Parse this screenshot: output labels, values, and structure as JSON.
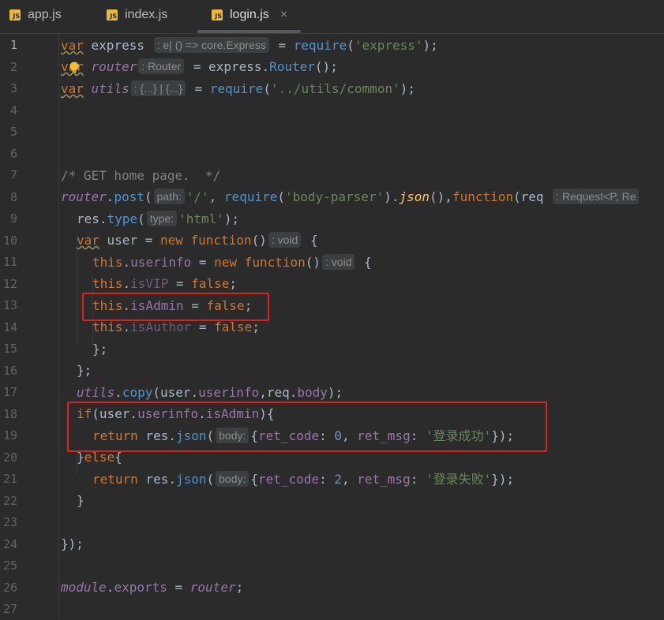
{
  "tabs": [
    {
      "label": "app.js",
      "icon": "js-icon",
      "active": false
    },
    {
      "label": "index.js",
      "icon": "js-icon",
      "active": false
    },
    {
      "label": "login.js",
      "icon": "js-icon",
      "active": true,
      "close": "×"
    }
  ],
  "js_badge": "JS",
  "line_numbers": [
    "1",
    "2",
    "3",
    "4",
    "5",
    "6",
    "7",
    "8",
    "9",
    "10",
    "11",
    "12",
    "13",
    "14",
    "15",
    "16",
    "17",
    "18",
    "19",
    "20",
    "21",
    "22",
    "23",
    "24",
    "25",
    "26",
    "27"
  ],
  "code": {
    "l1": {
      "kw": "var",
      "name": " express ",
      "hint": ": e| () => core.Express",
      "rest_a": " = ",
      "fn": "require",
      "rest_b": "(",
      "str": "'express'",
      "rest_c": ");"
    },
    "l2": {
      "kw": "var",
      "name": "router",
      "hint": ": Router",
      "rest_a": " = express.",
      "method": "Router",
      "rest_b": "();"
    },
    "l3": {
      "kw": "var",
      "name": "utils",
      "hint": ": {...} | {...}",
      "rest_a": " = ",
      "fn": "require",
      "rest_b": "(",
      "str": "'../utils/common'",
      "rest_c": ");"
    },
    "l7": {
      "cmt": "/* GET home page.  */"
    },
    "l8": {
      "obj": "router",
      "dot": ".",
      "method": "post",
      "open": "(",
      "hint1": "path:",
      "str1": "'/'",
      "sep1": ", ",
      "fn": "require",
      "open2": "(",
      "str2": "'body-parser'",
      "close2": ").",
      "method2": "json",
      "close3": "(),",
      "kw": "function",
      "open3": "(req ",
      "hint2": ": Request<P, Re"
    },
    "l9": {
      "a": "res.",
      "method": "type",
      "open": "(",
      "hint": "type:",
      "str": "'html'",
      "close": ");"
    },
    "l10": {
      "kw": "var",
      "a": " user = ",
      "kw2": "new",
      "kw3": " function",
      "b": "()",
      "hint": ": void",
      "c": " {"
    },
    "l11": {
      "kw": "this",
      "dot": ".",
      "prop": "userinfo",
      "a": " = ",
      "kw2": "new",
      "kw3": " function",
      "b": "()",
      "hint": ": void",
      "c": " {"
    },
    "l12": {
      "kw": "this",
      "dot": ".",
      "prop": "isVIP",
      "a": " = ",
      "kw2": "false",
      "c": ";"
    },
    "l13": {
      "kw": "this",
      "dot": ".",
      "prop": "isAdmin",
      "a": " = ",
      "kw2": "false",
      "c": ";"
    },
    "l14": {
      "kw": "this",
      "dot": ".",
      "prop": "isAuthor",
      "a": " = ",
      "kw2": "false",
      "c": ";"
    },
    "l15": {
      "a": "};"
    },
    "l16": {
      "a": "};"
    },
    "l17": {
      "obj": "utils",
      "dot": ".",
      "method": "copy",
      "a": "(user.",
      "prop": "userinfo",
      "b": ",req.",
      "prop2": "body",
      "c": ");"
    },
    "l18": {
      "kw": "if",
      "a": "(user.",
      "prop": "userinfo",
      "dot": ".",
      "prop2": "isAdmin",
      "c": "){"
    },
    "l19": {
      "kw": "return",
      "a": " res.",
      "method": "json",
      "open": "(",
      "hint": "body:",
      "b": "{",
      "prop": "ret_code",
      "colon": ": ",
      "num": "0",
      "sep": ", ",
      "prop2": "ret_msg",
      "colon2": ": ",
      "str": "'登录成功'",
      "c": "});"
    },
    "l20": {
      "a": "}",
      "kw": "else",
      "b": "{"
    },
    "l21": {
      "kw": "return",
      "a": " res.",
      "method": "json",
      "open": "(",
      "hint": "body:",
      "b": "{",
      "prop": "ret_code",
      "colon": ": ",
      "num": "2",
      "sep": ", ",
      "prop2": "ret_msg",
      "colon2": ": ",
      "str": "'登录失败'",
      "c": "});"
    },
    "l22": {
      "a": "}"
    },
    "l24": {
      "a": "});"
    },
    "l26": {
      "obj": "module",
      "dot": ".",
      "prop": "exports",
      "a": " = ",
      "obj2": "router",
      "c": ";"
    }
  },
  "colors": {
    "background": "#2b2b2b",
    "keyword": "#cc7832",
    "string": "#6a8759",
    "number": "#6897bb",
    "property": "#9876aa",
    "highlight_box": "#e0201a"
  }
}
